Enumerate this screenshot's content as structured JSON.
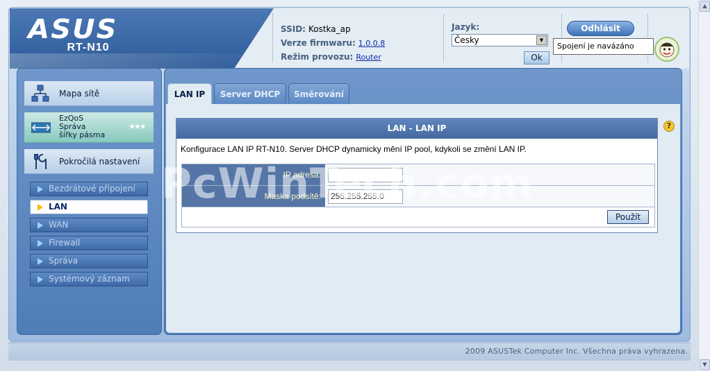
{
  "header": {
    "brand": "ASUS",
    "model": "RT-N10",
    "ssid_label": "SSID:",
    "ssid_value": "Kostka_ap",
    "firmware_label": "Verze firmwaru:",
    "firmware_value": "1.0.0.8",
    "mode_label": "Režim provozu:",
    "mode_value": "Router",
    "language_label": "Jazyk:",
    "language_selected": "Česky",
    "ok_label": "Ok",
    "logout_label": "Odhlásit",
    "connection_status": "Spojení je navázáno"
  },
  "sidebar": {
    "network_map": "Mapa sítě",
    "ezqos": "EzQoS\nSpráva\nšířky pásma",
    "advanced": "Pokročilá nastavení",
    "items": [
      {
        "label": "Bezdrátové připojení",
        "active": false
      },
      {
        "label": "LAN",
        "active": true
      },
      {
        "label": "WAN",
        "active": false
      },
      {
        "label": "Firewall",
        "active": false
      },
      {
        "label": "Správa",
        "active": false
      },
      {
        "label": "Systémový záznam",
        "active": false
      }
    ]
  },
  "tabs": [
    {
      "label": "LAN IP",
      "active": true
    },
    {
      "label": "Server DHCP",
      "active": false
    },
    {
      "label": "Směrování",
      "active": false
    }
  ],
  "section": {
    "title": "LAN - LAN IP",
    "description": "Konfigurace LAN IP RT-N10. Server DHCP dynamicky mění IP pool, kdykoli se změní LAN IP.",
    "ip_label": "IP adresa:",
    "ip_value": "",
    "mask_label": "Maska podsítě:",
    "mask_value": "255.255.255.0",
    "apply_label": "Použít"
  },
  "watermark": "PcWinTech.com",
  "footer": {
    "copyright": "2009 ASUSTek Computer Inc. Všechna práva vyhrazena."
  },
  "colors": {
    "accent": "#44699f",
    "label_text": "#fbf6c0",
    "active_marker": "#f0c000"
  }
}
